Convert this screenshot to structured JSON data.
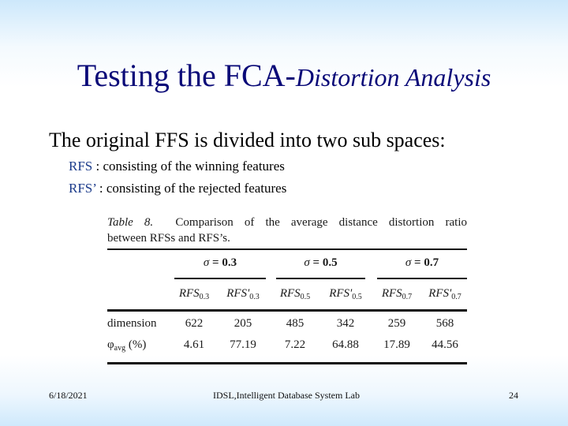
{
  "slide": {
    "title_main": "Testing the FCA-",
    "title_italic": "Distortion Analysis",
    "body_text": "The original FFS is divided into two sub spaces:",
    "bullets": [
      {
        "key": "RFS",
        "text": " : consisting of the winning features"
      },
      {
        "key": "RFS’",
        "text": " : consisting of the rejected features"
      }
    ]
  },
  "table": {
    "caption_label": "Table 8.",
    "caption_line1": "Comparison of the average distance distortion ratio",
    "caption_line2": "between RFSs and RFS’s.",
    "sigma_symbol": "σ",
    "sigma_groups": [
      "= 0.3",
      "= 0.5",
      "= 0.7"
    ],
    "column_headers": [
      {
        "base": "RFS",
        "sub": "0.3"
      },
      {
        "base": "RFS'",
        "sub": "0.3"
      },
      {
        "base": "RFS",
        "sub": "0.5"
      },
      {
        "base": "RFS'",
        "sub": "0.5"
      },
      {
        "base": "RFS",
        "sub": "0.7"
      },
      {
        "base": "RFS'",
        "sub": "0.7"
      }
    ],
    "rows": [
      {
        "label": "dimension",
        "label_sub": "",
        "label_suffix": "",
        "values": [
          "622",
          "205",
          "485",
          "342",
          "259",
          "568"
        ]
      },
      {
        "label": "φ",
        "label_sub": "avg",
        "label_suffix": " (%)",
        "values": [
          "4.61",
          "77.19",
          "7.22",
          "64.88",
          "17.89",
          "44.56"
        ]
      }
    ]
  },
  "footer": {
    "date": "6/18/2021",
    "lab": "IDSL,Intelligent Database System Lab",
    "page_number": "24"
  }
}
